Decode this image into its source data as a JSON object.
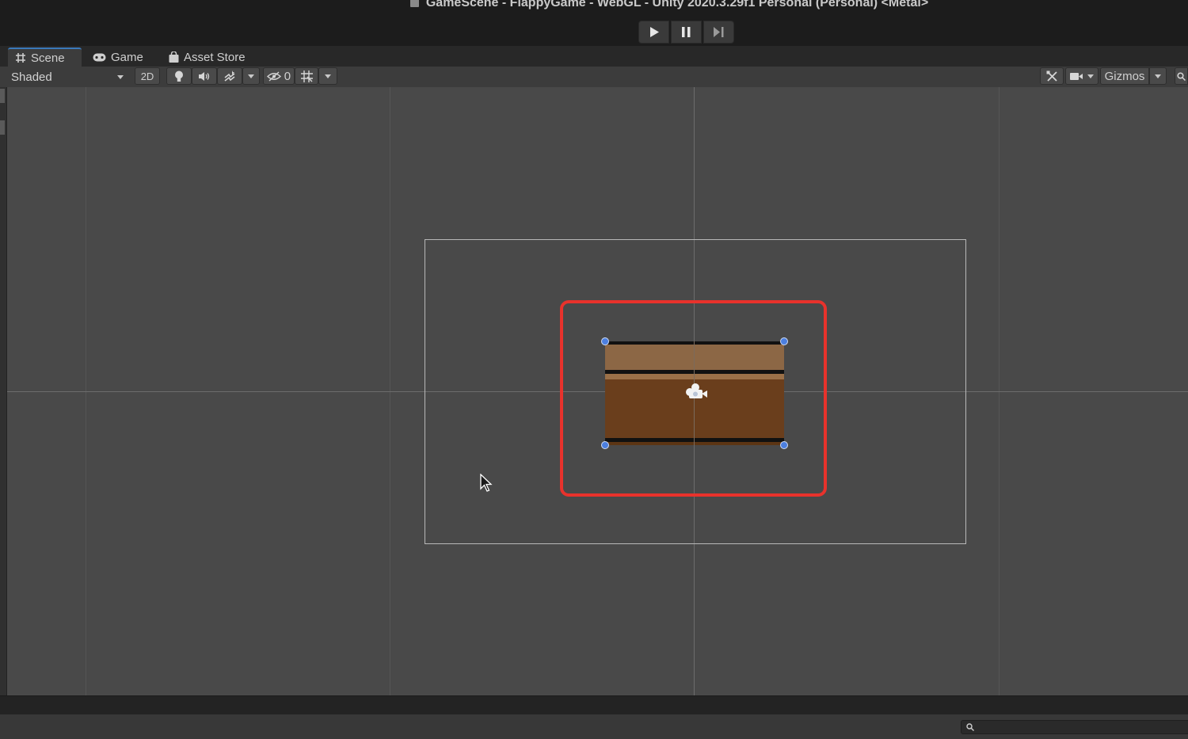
{
  "window": {
    "title": "GameScene - FlappyGame - WebGL - Unity 2020.3.29f1 Personal (Personal) <Metal>"
  },
  "playbar": {
    "buttons": [
      {
        "name": "play-button",
        "icon": "play-icon"
      },
      {
        "name": "pause-button",
        "icon": "pause-icon"
      },
      {
        "name": "step-button",
        "icon": "step-icon"
      }
    ]
  },
  "tabs": [
    {
      "label": "Scene",
      "icon": "grid-icon",
      "active": true
    },
    {
      "label": "Game",
      "icon": "gamepad-icon",
      "active": false
    },
    {
      "label": "Asset Store",
      "icon": "shopping-bag-icon",
      "active": false
    }
  ],
  "toolbar": {
    "draw_mode": "Shaded",
    "mode_2d": "2D",
    "hidden_count": "0",
    "gizmos_label": "Gizmos"
  },
  "scene": {
    "selected_object": "sprite",
    "highlight_color": "#e8322c",
    "handle_color": "#4c7fe0",
    "sprite_colors": {
      "top": "#8c6745",
      "body": "#6a3e1c",
      "outline": "#111111"
    }
  },
  "colors": {
    "scene_background": "#494949",
    "accent": "#3a79bb"
  }
}
